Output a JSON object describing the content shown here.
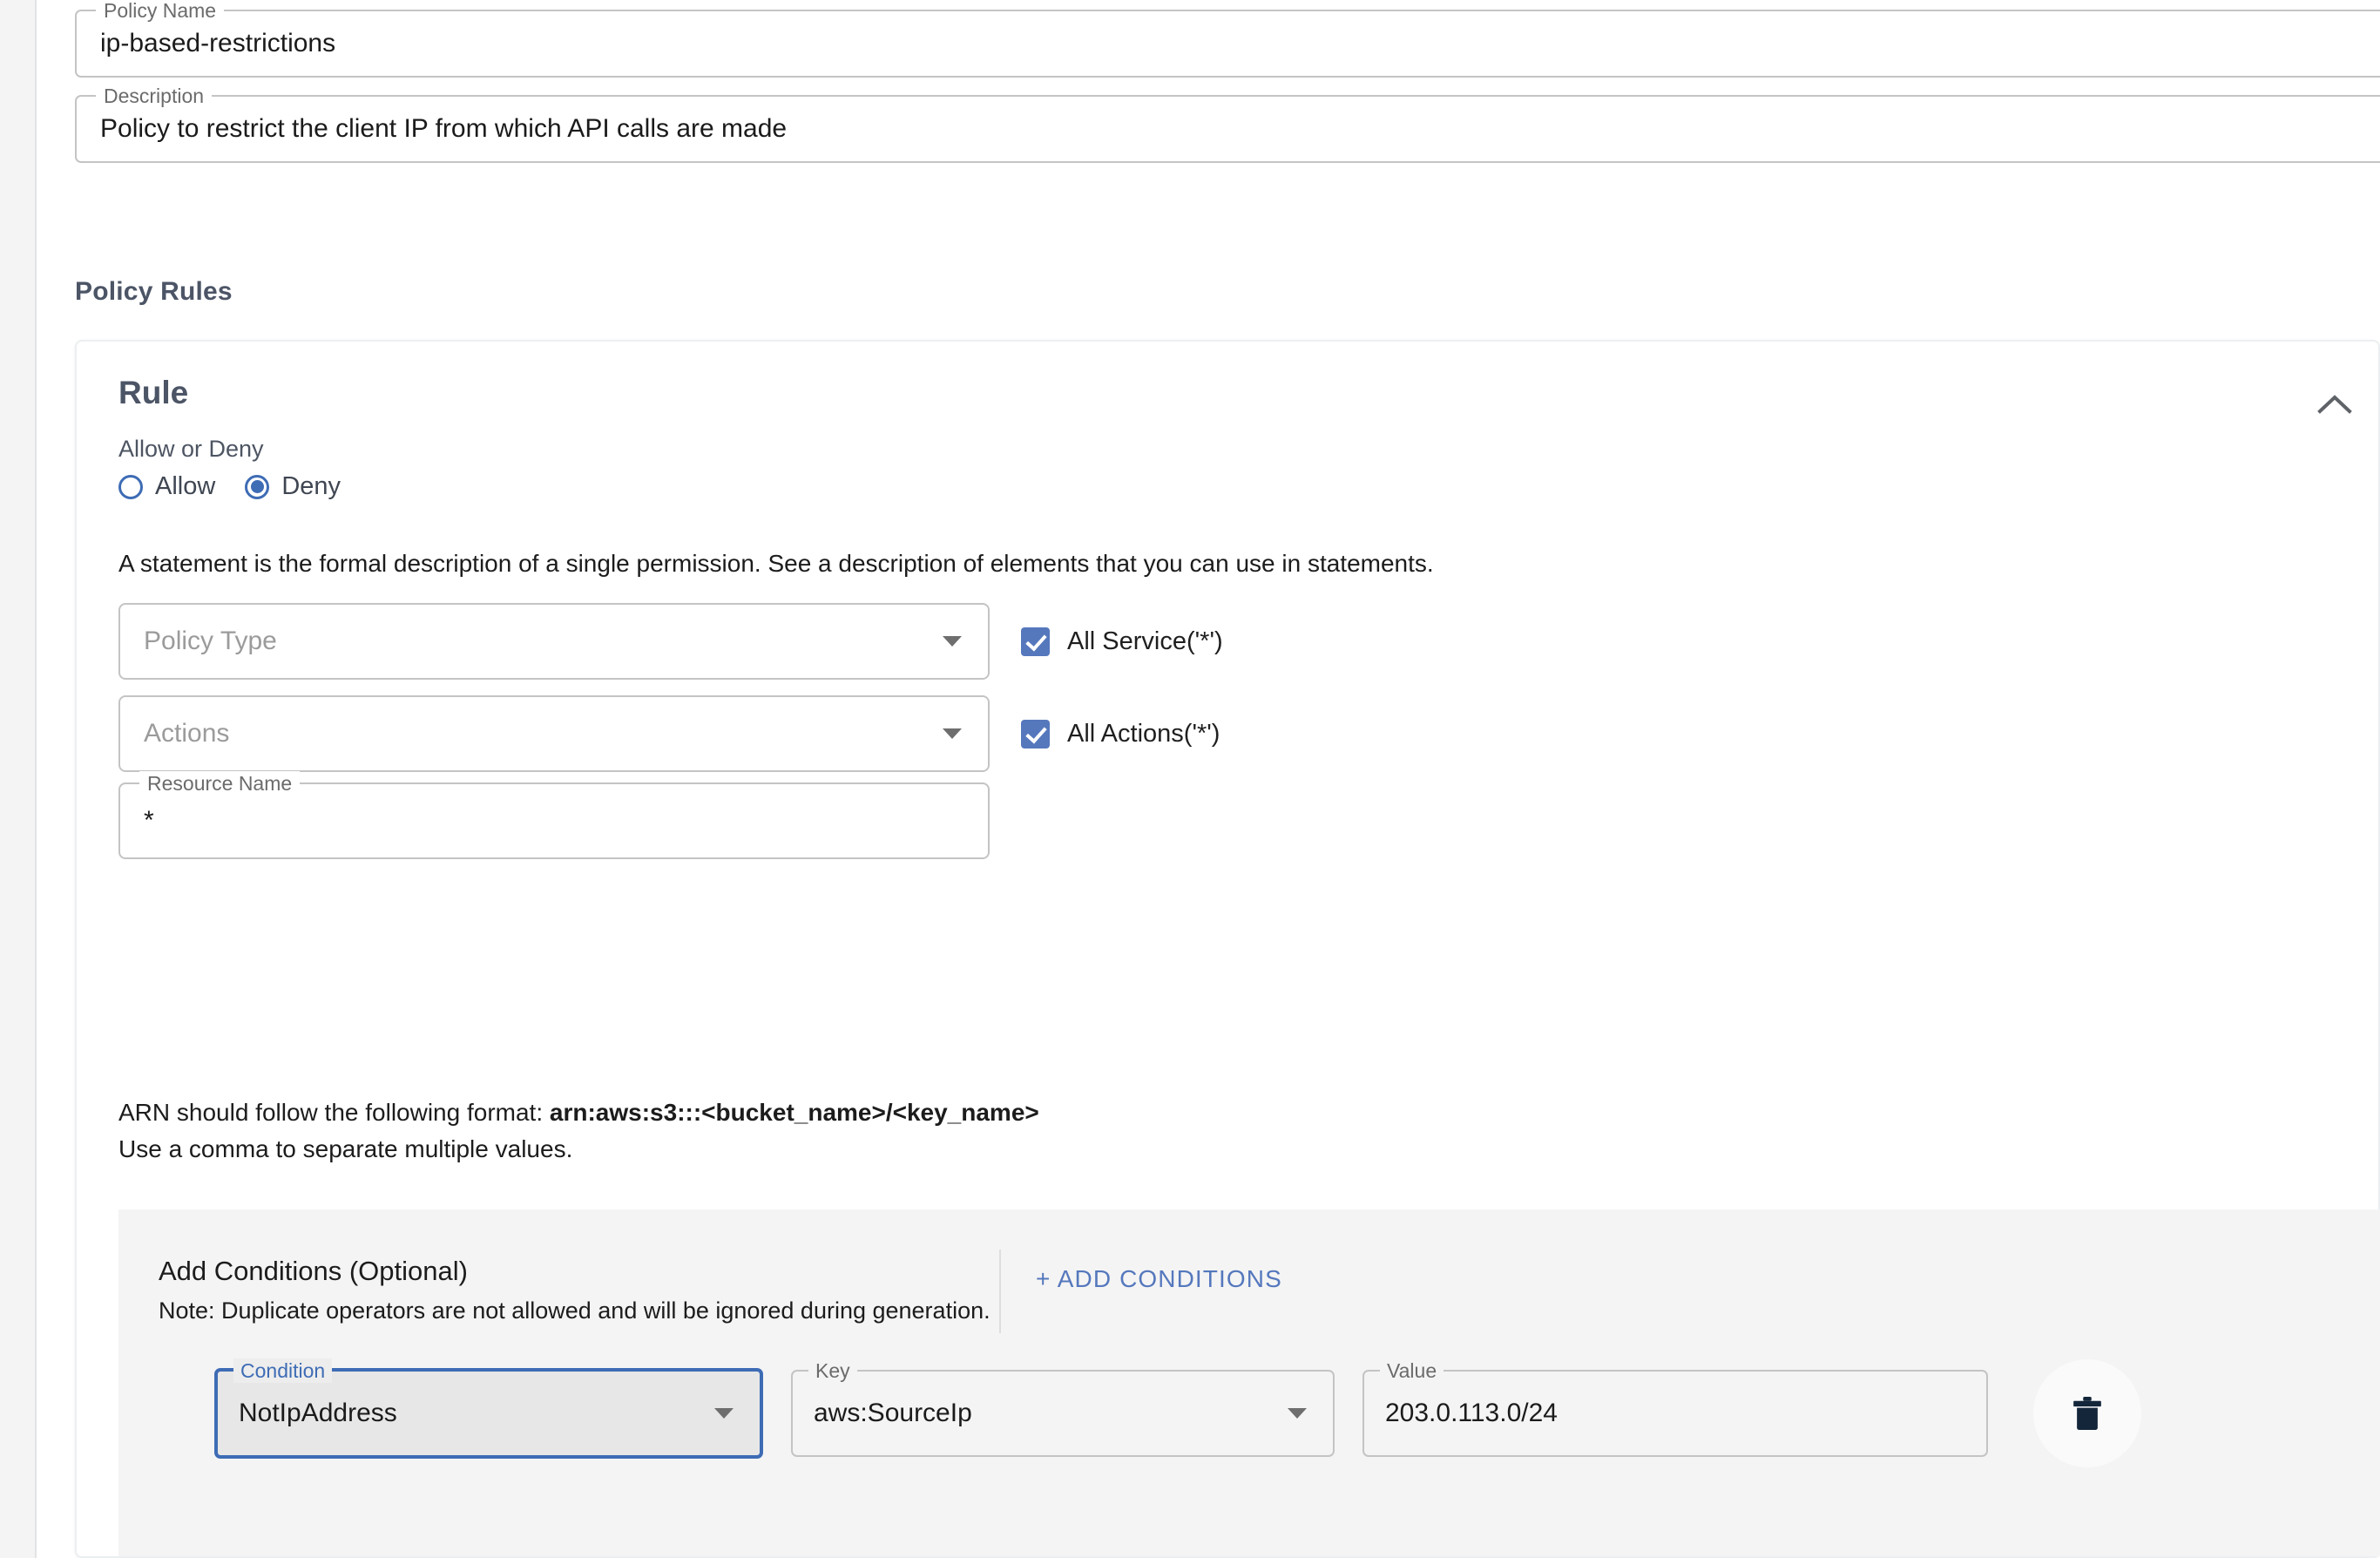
{
  "form": {
    "policy_name": {
      "legend": "Policy Name",
      "value": "ip-based-restrictions"
    },
    "description": {
      "legend": "Description",
      "value": "Policy to restrict the client IP from which API calls are made"
    }
  },
  "section": {
    "policy_rules_heading": "Policy Rules"
  },
  "rule": {
    "title": "Rule",
    "collapse_icon": "chevron-up-icon",
    "allow_deny_label": "Allow or Deny",
    "options": [
      {
        "label": "Allow",
        "checked": false
      },
      {
        "label": "Deny",
        "checked": true
      }
    ],
    "statement_note": "A statement is the formal description of a single permission. See a description of elements that you can use in statements.",
    "policy_type": {
      "placeholder": "Policy Type",
      "value": "",
      "caret_icon": "chevron-down-icon"
    },
    "all_service_checkbox": {
      "label": "All Service('*')",
      "checked": true
    },
    "actions": {
      "placeholder": "Actions",
      "value": "",
      "caret_icon": "chevron-down-icon"
    },
    "all_actions_checkbox": {
      "label": "All Actions('*')",
      "checked": true
    },
    "resource_name": {
      "legend": "Resource Name",
      "value": "*"
    },
    "arn_help_prefix": "ARN should follow the following format: ",
    "arn_help_format": "arn:aws:s3:::<bucket_name>/<key_name>",
    "arn_help_line2": "Use a comma to separate multiple values."
  },
  "conditions": {
    "title": "Add Conditions (Optional)",
    "note": "Note: Duplicate operators are not allowed and will be ignored during generation.",
    "add_button_label": "+ ADD CONDITIONS",
    "rows": [
      {
        "condition": {
          "legend": "Condition",
          "value": "NotIpAddress",
          "focused": true,
          "caret_icon": "chevron-down-icon"
        },
        "key": {
          "legend": "Key",
          "value": "aws:SourceIp",
          "caret_icon": "chevron-down-icon"
        },
        "value": {
          "legend": "Value",
          "value": "203.0.113.0/24"
        },
        "delete_icon": "trash-icon"
      }
    ]
  },
  "colors": {
    "accent_blue": "#3e6cb5",
    "checkbox_blue": "#5578bd",
    "heading_slate": "#4c5566",
    "panel_grey": "#f4f4f4",
    "field_border": "#c4c4c4",
    "trash_navy": "#13263a"
  }
}
